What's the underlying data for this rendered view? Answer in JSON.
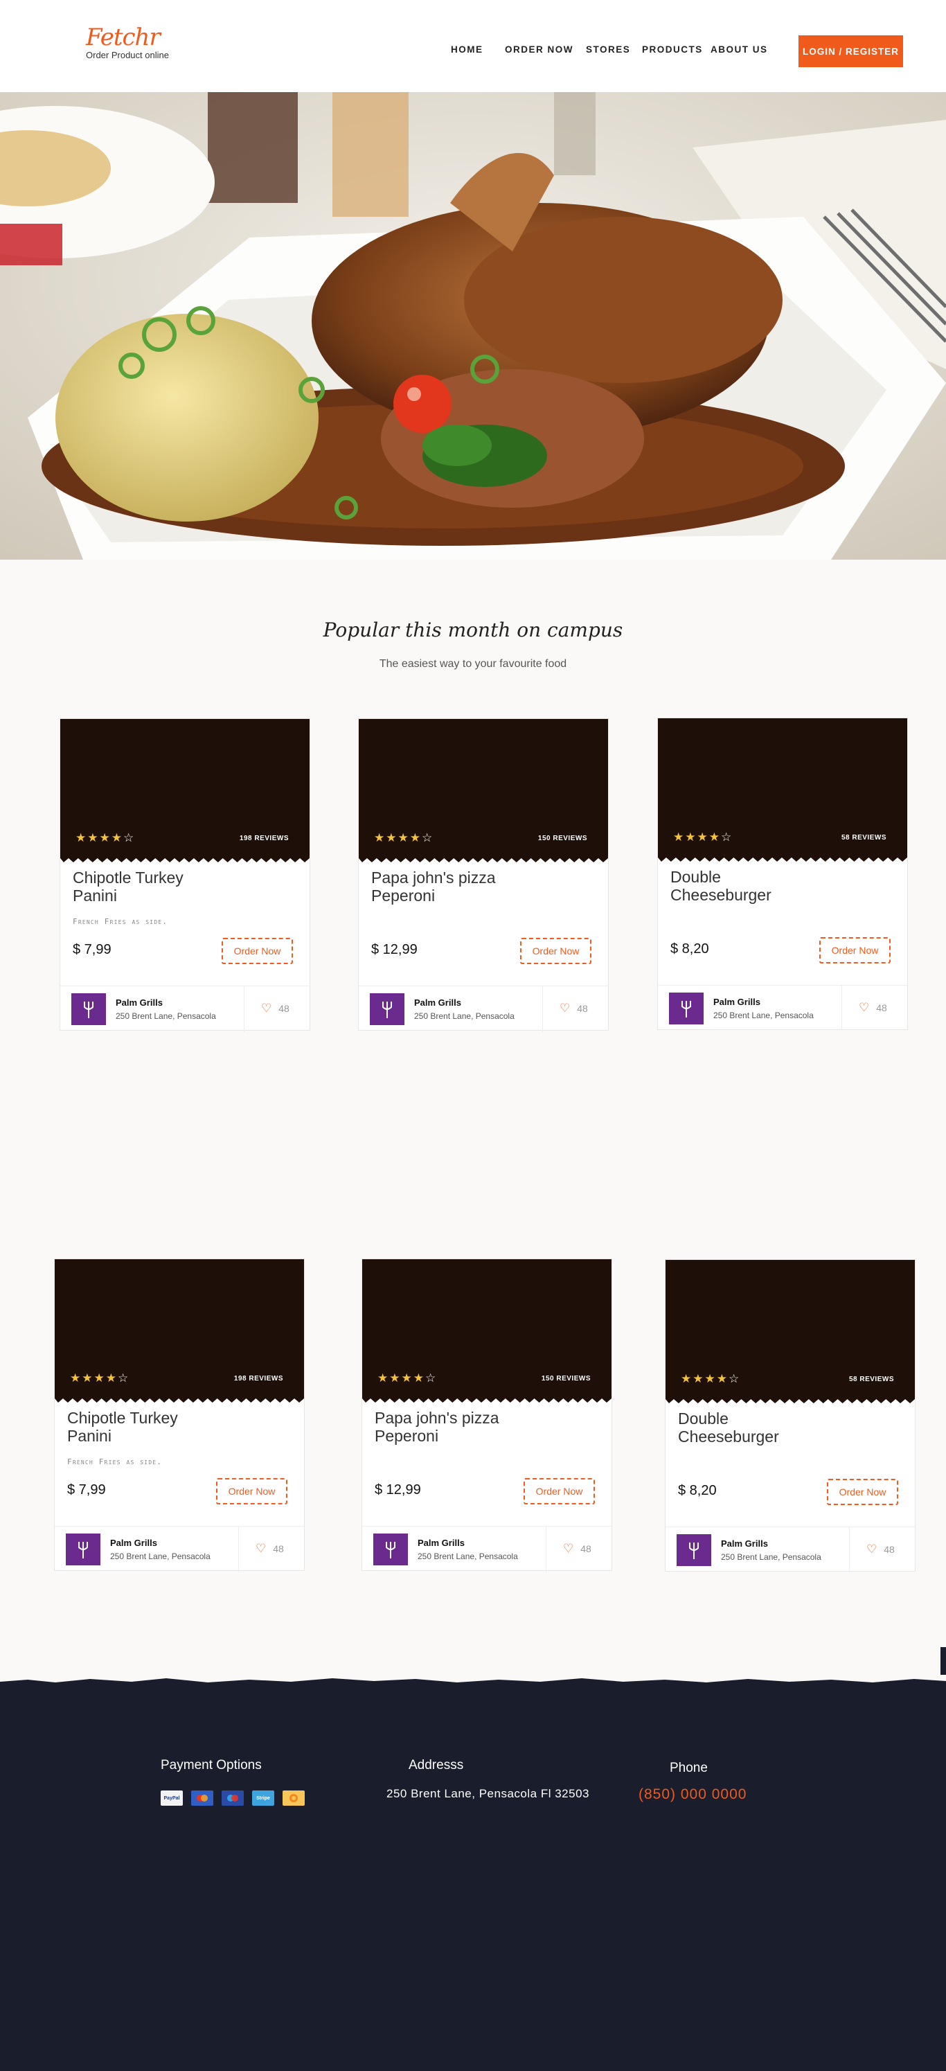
{
  "brand": {
    "name": "Fetchr",
    "tagline": "Order Product online"
  },
  "nav": [
    "HOME",
    "ORDER NOW",
    "STORES",
    "PRODUCTS",
    "ABOUT US"
  ],
  "login_label": "LOGIN / REGISTER",
  "section": {
    "title": "Popular this month on campus",
    "subtitle": "The easiest way to your favourite food"
  },
  "cards": [
    {
      "title": "Chipotle Turkey Panini",
      "note": "French Fries as side.",
      "price": "$ 7,99",
      "reviews": "198 REVIEWS",
      "rating": 4,
      "order_label": "Order Now",
      "store": "Palm Grills",
      "address": "250 Brent Lane, Pensacola",
      "likes": "48"
    },
    {
      "title": "Papa john's pizza Peperoni",
      "note": "",
      "price": "$ 12,99",
      "reviews": "150 REVIEWS",
      "rating": 4,
      "order_label": "Order Now",
      "store": "Palm Grills",
      "address": "250 Brent Lane, Pensacola",
      "likes": "48"
    },
    {
      "title": "Double Cheeseburger",
      "note": "",
      "price": "$ 8,20",
      "reviews": "58 REVIEWS",
      "rating": 4,
      "order_label": "Order Now",
      "store": "Palm Grills",
      "address": "250 Brent Lane, Pensacola",
      "likes": "48"
    },
    {
      "title": "Chipotle Turkey Panini",
      "note": "French Fries as side.",
      "price": "$ 7,99",
      "reviews": "198 REVIEWS",
      "rating": 4,
      "order_label": "Order Now",
      "store": "Palm Grills",
      "address": "250 Brent Lane, Pensacola",
      "likes": "48"
    },
    {
      "title": "Papa john's pizza Peperoni",
      "note": "",
      "price": "$ 12,99",
      "reviews": "150 REVIEWS",
      "rating": 4,
      "order_label": "Order Now",
      "store": "Palm Grills",
      "address": "250 Brent Lane, Pensacola",
      "likes": "48"
    },
    {
      "title": "Double Cheeseburger",
      "note": "",
      "price": "$ 8,20",
      "reviews": "58 REVIEWS",
      "rating": 4,
      "order_label": "Order Now",
      "store": "Palm Grills",
      "address": "250 Brent Lane, Pensacola",
      "likes": "48"
    }
  ],
  "footer": {
    "payment_heading": "Payment Options",
    "payment_methods": [
      "PayPal",
      "Mastercard",
      "Maestro",
      "Stripe",
      "Bitcoin"
    ],
    "address_heading": "Addresss",
    "address": "250 Brent Lane, Pensacola Fl 32503",
    "phone_heading": "Phone",
    "phone": "(850) 000 0000"
  },
  "colors": {
    "accent": "#f05a1a",
    "footer_bg": "#1a1e2c",
    "card_image_bg": "#1e0f08",
    "store_logo_bg": "#6b2b8e",
    "star": "#f5c23c"
  }
}
